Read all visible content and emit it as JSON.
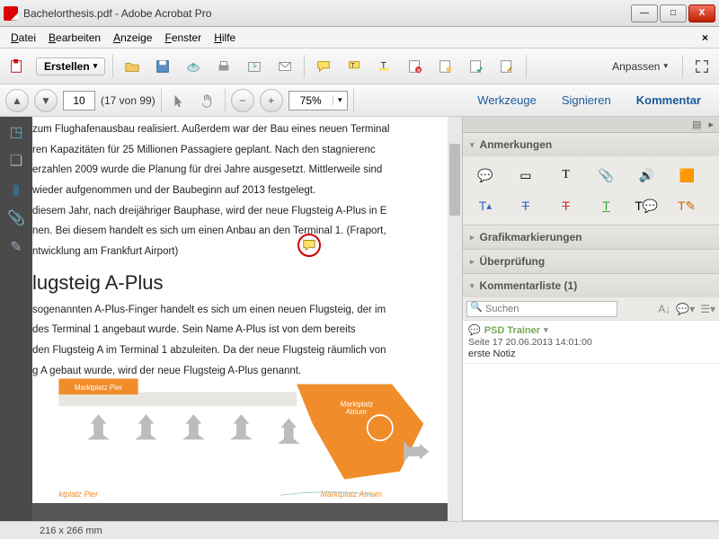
{
  "title": "Bachelorthesis.pdf - Adobe Acrobat Pro",
  "menu": {
    "datei": "Datei",
    "bearbeiten": "Bearbeiten",
    "anzeige": "Anzeige",
    "fenster": "Fenster",
    "hilfe": "Hilfe"
  },
  "toolbar": {
    "erstellen": "Erstellen",
    "anpassen": "Anpassen"
  },
  "nav": {
    "page": "10",
    "count": "(17 von 99)",
    "zoom": "75%"
  },
  "tabs": {
    "werkzeuge": "Werkzeuge",
    "signieren": "Signieren",
    "kommentar": "Kommentar"
  },
  "doc": {
    "p1": "zum Flughafenausbau realisiert. Außerdem war der Bau eines neuen Terminal",
    "p2": "ren Kapazitäten für 25 Millionen Passagiere geplant. Nach den stagnierenc",
    "p3": "erzahlen 2009 wurde die Planung für drei Jahre ausgesetzt. Mittlerweile sind",
    "p4": "wieder aufgenommen und der Baubeginn auf 2013 festgelegt.",
    "p5": "diesem Jahr, nach dreijähriger Bauphase, wird der neue Flugsteig A-Plus in E",
    "p6": "nen. Bei diesem handelt es sich um einen Anbau an den Terminal 1. (Fraport,",
    "p7": "ntwicklung am Frankfurt Airport)",
    "h": "lugsteig A-Plus",
    "p8": "sogenannten A-Plus-Finger handelt es sich um einen neuen Flugsteig, der im",
    "p9": "des Terminal 1 angebaut wurde. Sein Name A-Plus ist von dem bereits",
    "p10": "den Flugsteig A im Terminal 1 abzuleiten. Da der neue Flugsteig räumlich von",
    "p11": "g A gebaut wurde, wird der neue Flugsteig A-Plus genannt.",
    "lbl_pier": "Marktplatz Pier",
    "lbl_atrium": "Marktplatz\nAtrium",
    "lbl_pier2": "ktplatz Pier",
    "lbl_atrium2": "Marktplatz Atrium"
  },
  "status": "216 x 266 mm",
  "panel": {
    "anmerkungen": "Anmerkungen",
    "grafik": "Grafikmarkierungen",
    "ueberpr": "Überprüfung",
    "liste": "Kommentarliste (1)",
    "search": "Suchen"
  },
  "comment": {
    "author": "PSD Trainer",
    "meta": "Seite 17   20.06.2013 14:01:00",
    "body": "erste Notiz"
  }
}
